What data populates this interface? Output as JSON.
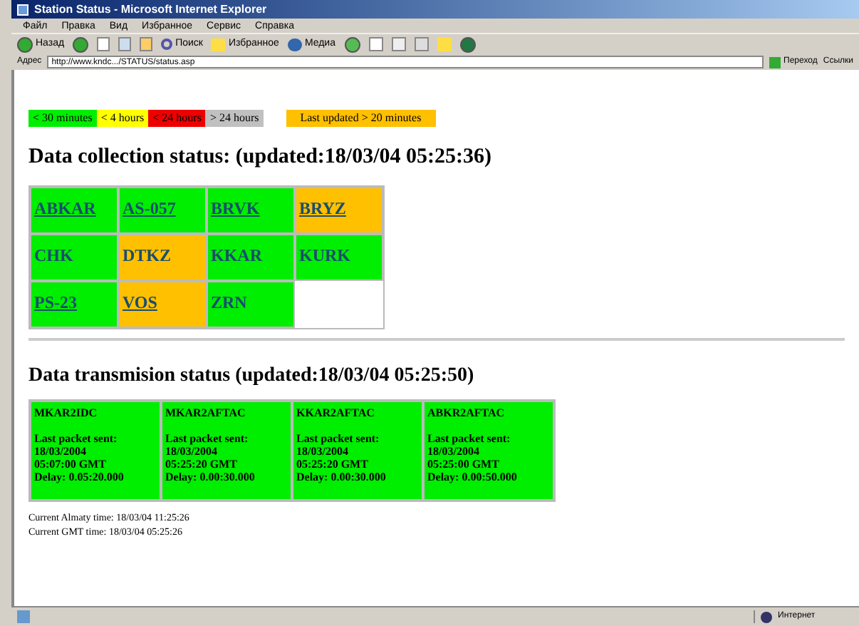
{
  "window": {
    "title": "Station Status - Microsoft Internet Explorer"
  },
  "menu": [
    "Файл",
    "Правка",
    "Вид",
    "Избранное",
    "Сервис",
    "Справка"
  ],
  "toolbar": {
    "back": "Назад",
    "search": "Поиск",
    "favorites": "Избранное",
    "media": "Медиа"
  },
  "address": {
    "label": "Адрес",
    "value": "http://www.kndc.../STATUS/status.asp",
    "go": "Переход",
    "links": "Ссылки"
  },
  "legend": [
    {
      "label": "< 30 minutes",
      "color": "#00ee00"
    },
    {
      "label": "< 4 hours",
      "color": "#ffff00"
    },
    {
      "label": "< 24 hours",
      "color": "#ee0000"
    },
    {
      "label": "> 24 hours",
      "color": "#c0c0c0"
    },
    {
      "label": "Last updated > 20 minutes",
      "color": "#ffc000"
    }
  ],
  "collection": {
    "heading": "Data collection status: (updated:18/03/04 05:25:36)",
    "rows": [
      [
        {
          "code": "ABKAR",
          "color": "#00ee00",
          "link": true
        },
        {
          "code": "AS-057",
          "color": "#00ee00",
          "link": true
        },
        {
          "code": "BRVK",
          "color": "#00ee00",
          "link": true
        },
        {
          "code": "BRYZ",
          "color": "#ffc000",
          "link": true
        }
      ],
      [
        {
          "code": "CHK",
          "color": "#00ee00",
          "link": false
        },
        {
          "code": "DTKZ",
          "color": "#ffc000",
          "link": false
        },
        {
          "code": "KKAR",
          "color": "#00ee00",
          "link": false
        },
        {
          "code": "KURK",
          "color": "#00ee00",
          "link": false
        }
      ],
      [
        {
          "code": "PS-23",
          "color": "#00ee00",
          "link": true
        },
        {
          "code": "VOS",
          "color": "#ffc000",
          "link": true
        },
        {
          "code": "ZRN",
          "color": "#00ee00",
          "link": false
        }
      ]
    ]
  },
  "transmission": {
    "heading": "Data transmision status (updated:18/03/04 05:25:50)",
    "links": [
      {
        "name": "MKAR2IDC",
        "color": "#00ee00",
        "lines": [
          "Last packet sent:",
          "18/03/2004",
          "05:07:00 GMT",
          "Delay: 0.05:20.000"
        ]
      },
      {
        "name": "MKAR2AFTAC",
        "color": "#00ee00",
        "lines": [
          "Last packet sent:",
          "18/03/2004",
          "05:25:20 GMT",
          "Delay: 0.00:30.000"
        ]
      },
      {
        "name": "KKAR2AFTAC",
        "color": "#00ee00",
        "lines": [
          "Last packet sent:",
          "18/03/2004",
          "05:25:20 GMT",
          "Delay: 0.00:30.000"
        ]
      },
      {
        "name": "ABKR2AFTAC",
        "color": "#00ee00",
        "lines": [
          "Last packet sent:",
          "18/03/2004",
          "05:25:00 GMT",
          "Delay: 0.00:50.000"
        ]
      }
    ]
  },
  "footer": [
    "Current Almaty time: 18/03/04 11:25:26",
    "Current GMT time: 18/03/04 05:25:26"
  ],
  "status_bar": {
    "zone": "Интернет"
  }
}
